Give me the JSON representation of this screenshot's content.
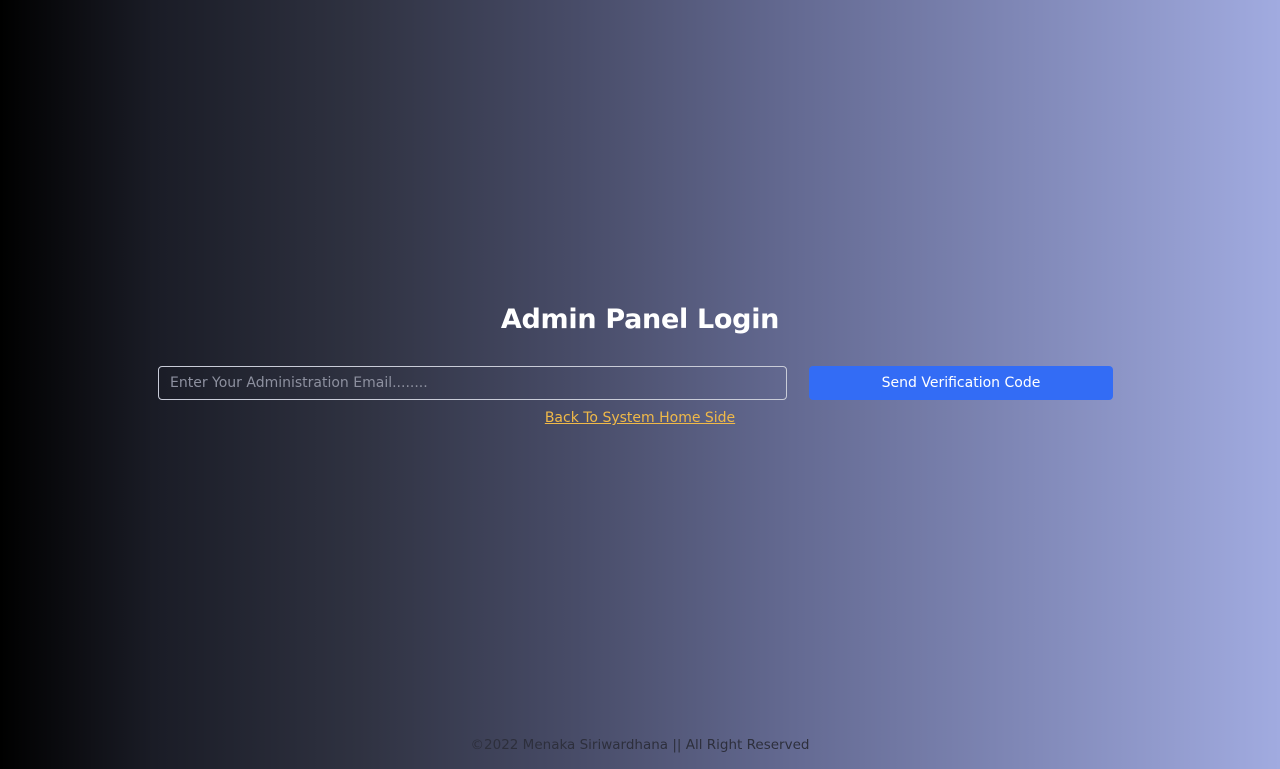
{
  "login": {
    "title": "Admin Panel Login",
    "email_placeholder": "Enter Your Administration Email........",
    "email_value": "",
    "send_button_label": "Send Verification Code",
    "back_link_label": "Back To System Home Side"
  },
  "footer": {
    "copyright": "©2022 Menaka Siriwardhana || All Right Reserved"
  },
  "colors": {
    "primary_button": "#336cf5",
    "link": "#f0b948",
    "background_start": "#000000",
    "background_end": "#a1abe0"
  }
}
